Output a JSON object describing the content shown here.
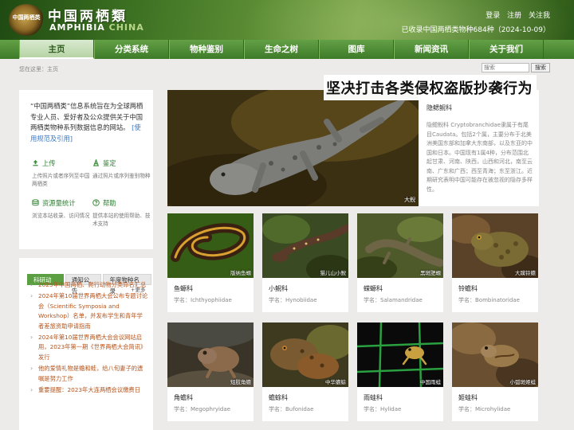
{
  "header": {
    "logo_badge": "中国两栖类",
    "logo_cn": "中国两栖類",
    "logo_en_main": "AMPHIBIA",
    "logo_en_sub": "CHINA",
    "links": [
      "登录",
      "注册",
      "关注我"
    ],
    "species_count": "已收录中国两栖类物种684种（2024-10-09）"
  },
  "nav": {
    "items": [
      "主页",
      "分类系统",
      "物种鉴别",
      "生命之树",
      "图库",
      "新闻资讯",
      "关于我们"
    ],
    "active": "主页"
  },
  "breadcrumb": "您在这里：主页",
  "search": {
    "placeholder": "搜索",
    "button": "搜索"
  },
  "banner": "坚决打击各类侵权盗版抄袭行为",
  "intro": {
    "text": "“中国两栖类”信息系统旨在为全球两栖专业人员、爱好者及公众提供关于中国两栖类物种系列数据信息的网站。",
    "link": "[使用规范及引用]",
    "features": [
      {
        "title": "上传",
        "desc": "上传照片或者序列至中国两栖类",
        "icon": "upload-icon"
      },
      {
        "title": "鉴定",
        "desc": "通过照片或序列鉴别物种",
        "icon": "identify-icon"
      },
      {
        "title": "资源量统计",
        "desc": "浏览本站收录、访问情况",
        "icon": "stats-icon"
      },
      {
        "title": "帮助",
        "desc": "提供本站的使用帮助、技术支持",
        "icon": "help-icon"
      }
    ]
  },
  "news": {
    "tabs": [
      "科研动态",
      "通知公告",
      "年度物种名录"
    ],
    "active_tab": "科研动态",
    "more": "+更多",
    "items": [
      "2023年中国两栖、爬行动物分类命名汇总",
      "2024年第10届世界两栖大会公布专题讨论会（Scientific Symposia and Workshop）名单，并发布学生和青年学者差旅资助申请指南",
      "2024年第10届世界两栖大会会议网站启用，2023年第一期《世界两栖大会简讯》发行",
      "他的爱情礼物是蟾和蛙，给八旬妻子的遗嘱是努力工作",
      "重要提醒：2023年大连两栖会议缴费日"
    ]
  },
  "featured": {
    "title": "隐鳃鲵科",
    "text": "隐鳃鲵科 Cryptobranchidae隶属于有尾目Caudata。包括2个属，主要分布于北美洲美国东部和加拿大东南部，以及东亚的中国和日本。中国现有1属4种，分布范围北起甘肃、河南、陕西，山西和河北，南至云南、广东和广西；西至青海；东至浙江。近期研究表明中国可能存在被忽视的隐存多样性。",
    "photo_caption": "大鲵"
  },
  "families": [
    {
      "name": "鱼螈科",
      "sci": "学名：Ichthyophiidae",
      "caption": "版纳鱼螈"
    },
    {
      "name": "小鲵科",
      "sci": "学名：Hynobiidae",
      "caption": "猫儿山小鲵"
    },
    {
      "name": "蝾螈科",
      "sci": "学名：Salamandridae",
      "caption": "黑斑肥螈"
    },
    {
      "name": "铃蟾科",
      "sci": "学名：Bombinatoridae",
      "caption": "大蹼铃蟾"
    },
    {
      "name": "角蟾科",
      "sci": "学名：Megophryidae",
      "caption": "短肢角蟾"
    },
    {
      "name": "蟾蜍科",
      "sci": "学名：Bufonidae",
      "caption": "中华蟾蜍"
    },
    {
      "name": "雨蛙科",
      "sci": "学名：Hylidae",
      "caption": "中国雨蛙"
    },
    {
      "name": "姬蛙科",
      "sci": "学名：Microhylidae",
      "caption": "小弧斑姬蛙"
    }
  ]
}
